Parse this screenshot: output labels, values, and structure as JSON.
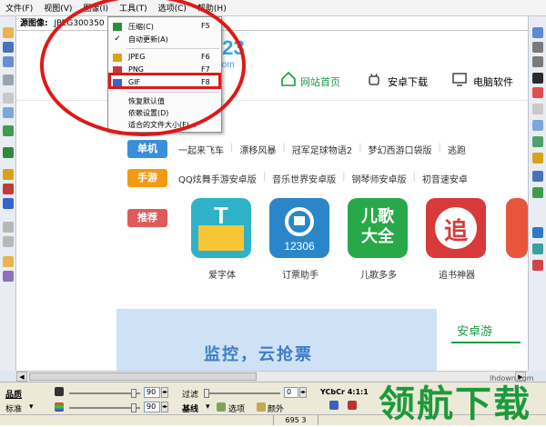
{
  "menu": [
    "文件(F)",
    "视图(V)",
    "图像(I)",
    "工具(T)",
    "选项(C)",
    "帮助(H)"
  ],
  "infobar": {
    "label": "源图像:",
    "value": "JPEG300350 字节"
  },
  "dropdown": {
    "items": [
      {
        "label": "压缩(C)",
        "shortcut": "F5",
        "icon": "compress-icon"
      },
      {
        "label": "自动更新(A)",
        "shortcut": "",
        "icon": "check-icon"
      },
      {
        "label": "JPEG",
        "shortcut": "F6",
        "icon": "jpeg-icon"
      },
      {
        "label": "PNG",
        "shortcut": "F7",
        "icon": "png-icon"
      },
      {
        "label": "GIF",
        "shortcut": "F8",
        "icon": "gif-icon"
      },
      {
        "label": "恢复默认值",
        "shortcut": "",
        "icon": ""
      },
      {
        "label": "依赖设置(D)",
        "shortcut": "",
        "icon": ""
      },
      {
        "label": "适合的文件大小(F)...",
        "shortcut": "",
        "icon": ""
      }
    ]
  },
  "website": {
    "logo_num": "123",
    "logo_domain": ".com",
    "nav": [
      "网站首页",
      "安卓下载",
      "电脑软件"
    ],
    "rows": [
      {
        "cat": "单机",
        "color": "#3a8fd9",
        "links": [
          "一起来飞车",
          "漂移风暴",
          "冠军足球物语2",
          "梦幻西游口袋版",
          "逃跑"
        ]
      },
      {
        "cat": "手游",
        "color": "#f39a12",
        "links": [
          "QQ炫舞手游安卓版",
          "音乐世界安卓版",
          "钢琴师安卓版",
          "初音速安卓"
        ]
      }
    ],
    "recommend": "推荐",
    "apps": [
      {
        "name": "爱字体",
        "glyph": "T"
      },
      {
        "name": "订票助手",
        "glyph": "12306"
      },
      {
        "name": "儿歌多多",
        "glyph": "儿歌\n大全"
      },
      {
        "name": "追书神器",
        "glyph": "追"
      }
    ],
    "banner_text": "监控，云抢票",
    "side_title": "安卓游"
  },
  "bottom": {
    "quality_label": "品质",
    "standard_label": "标准",
    "val1": "90",
    "val2": "90",
    "filter_label": "过滤",
    "filter_val": "0",
    "baseline_label": "基线",
    "options_label": "选项",
    "transparent_label": "颜外",
    "ycbcr_label": "YCbCr 4:1:1"
  },
  "status": {
    "coord": "695 3"
  },
  "watermark": {
    "text": "领航下载",
    "sub": "lhdown.com"
  }
}
